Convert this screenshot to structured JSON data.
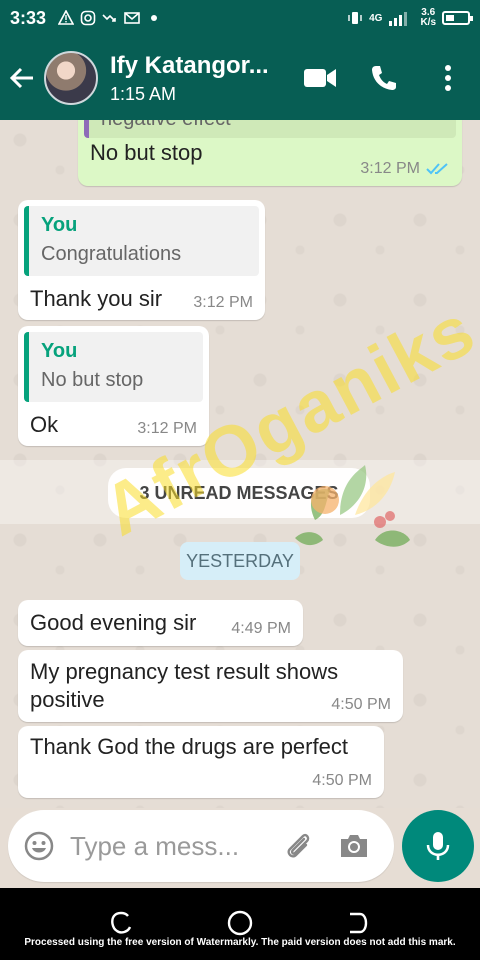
{
  "status_bar": {
    "time": "3:33",
    "network": "4G",
    "speed_value": "3.6",
    "speed_unit": "K/s",
    "icons": [
      "warning-icon",
      "instagram-icon",
      "missed-call-icon",
      "gmail-icon",
      "dot-icon",
      "vibrate-icon",
      "signal-icon",
      "battery-icon"
    ]
  },
  "header": {
    "contact_name": "Ify Katangor...",
    "subtitle": "1:15 AM"
  },
  "messages": {
    "m0": {
      "quote_text": "negative effect",
      "text": "No but stop",
      "time": "3:12 PM"
    },
    "m1": {
      "quote_author": "You",
      "quote_text": "Congratulations",
      "text": "Thank you sir",
      "time": "3:12 PM"
    },
    "m2": {
      "quote_author": "You",
      "quote_text": "No but stop",
      "text": "Ok",
      "time": "3:12 PM"
    },
    "m3": {
      "text": "Good evening sir",
      "time": "4:49 PM"
    },
    "m4": {
      "text": "My pregnancy test result shows positive",
      "time": "4:50 PM"
    },
    "m5": {
      "text": "Thank God the drugs are perfect",
      "time": "4:50 PM"
    }
  },
  "unread_label": "3 UNREAD MESSAGES",
  "date_label": "YESTERDAY",
  "watermark_text": "AfrOganiks",
  "input": {
    "placeholder": "Type a mess..."
  },
  "footer_text": "Processed using the free version of Watermarkly. The paid version does not add this mark.",
  "colors": {
    "header": "#075e54",
    "outgoing": "#dcf8c6",
    "incoming": "#ffffff",
    "accent": "#00897b",
    "read_ticks": "#4fc3f7"
  }
}
